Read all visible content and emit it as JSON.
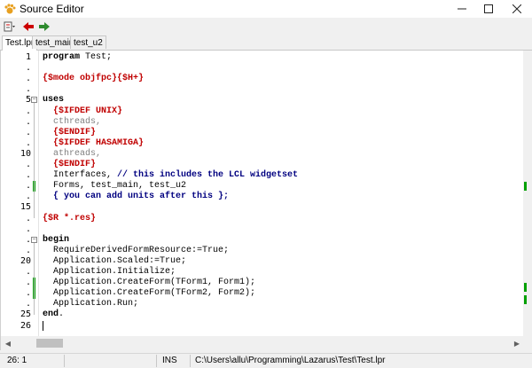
{
  "window": {
    "title": "Source Editor",
    "icon": "lazarus-paw-icon",
    "controls": [
      "minimize-icon",
      "maximize-icon",
      "close-icon"
    ]
  },
  "toolbar": {
    "buttons": [
      "jump-menu-icon",
      "back-arrow-icon",
      "forward-arrow-icon"
    ],
    "back_color": "#cc0000",
    "forward_color": "#2e8b2e"
  },
  "tabs": [
    {
      "label": "Test.lpr",
      "active": true
    },
    {
      "label": "test_main",
      "active": false
    },
    {
      "label": "test_u2",
      "active": false
    }
  ],
  "gutter": [
    {
      "label": "1"
    },
    {
      "label": "."
    },
    {
      "label": "."
    },
    {
      "label": "."
    },
    {
      "label": "5"
    },
    {
      "label": "."
    },
    {
      "label": "."
    },
    {
      "label": "."
    },
    {
      "label": "."
    },
    {
      "label": "10"
    },
    {
      "label": "."
    },
    {
      "label": "."
    },
    {
      "label": "."
    },
    {
      "label": "."
    },
    {
      "label": "15"
    },
    {
      "label": "."
    },
    {
      "label": "."
    },
    {
      "label": "."
    },
    {
      "label": "."
    },
    {
      "label": "20"
    },
    {
      "label": "."
    },
    {
      "label": "."
    },
    {
      "label": "."
    },
    {
      "label": "."
    },
    {
      "label": "25"
    },
    {
      "label": "26"
    }
  ],
  "code": [
    [
      {
        "t": "program",
        "c": "kw"
      },
      {
        "t": " Test;",
        "c": ""
      }
    ],
    [],
    [
      {
        "t": "{$mode objfpc}{$H+}",
        "c": "dir"
      }
    ],
    [],
    [
      {
        "t": "uses",
        "c": "kw"
      }
    ],
    [
      {
        "t": "  ",
        "c": ""
      },
      {
        "t": "{$IFDEF UNIX}",
        "c": "dir"
      }
    ],
    [
      {
        "t": "  cthreads,",
        "c": "inact"
      }
    ],
    [
      {
        "t": "  ",
        "c": ""
      },
      {
        "t": "{$ENDIF}",
        "c": "dir"
      }
    ],
    [
      {
        "t": "  ",
        "c": ""
      },
      {
        "t": "{$IFDEF HASAMIGA}",
        "c": "dir"
      }
    ],
    [
      {
        "t": "  athreads,",
        "c": "inact"
      }
    ],
    [
      {
        "t": "  ",
        "c": ""
      },
      {
        "t": "{$ENDIF}",
        "c": "dir"
      }
    ],
    [
      {
        "t": "  Interfaces, ",
        "c": ""
      },
      {
        "t": "// this includes the LCL widgetset",
        "c": "cmt"
      }
    ],
    [
      {
        "t": "  Forms, test_main, test_u2",
        "c": ""
      }
    ],
    [
      {
        "t": "  ",
        "c": ""
      },
      {
        "t": "{ you can add units after this };",
        "c": "cmt"
      }
    ],
    [],
    [
      {
        "t": "{$R *.res}",
        "c": "dir"
      }
    ],
    [],
    [
      {
        "t": "begin",
        "c": "kw"
      }
    ],
    [
      {
        "t": "  RequireDerivedFormResource:=True;",
        "c": ""
      }
    ],
    [
      {
        "t": "  Application.Scaled:=True;",
        "c": ""
      }
    ],
    [
      {
        "t": "  Application.Initialize;",
        "c": ""
      }
    ],
    [
      {
        "t": "  Application.CreateForm(TForm1, Form1);",
        "c": ""
      }
    ],
    [
      {
        "t": "  Application.CreateForm(TForm2, Form2);",
        "c": ""
      }
    ],
    [
      {
        "t": "  Application.Run;",
        "c": ""
      }
    ],
    [
      {
        "t": "end",
        "c": "kw"
      },
      {
        "t": ".",
        "c": ""
      }
    ],
    []
  ],
  "modified_line_indices": [
    12,
    21,
    22
  ],
  "fold_line_indices": [
    4,
    17
  ],
  "cursor_line_index": 25,
  "colors": {
    "keyword": "#000000",
    "directive": "#c00000",
    "inactive": "#808080",
    "comment": "#000080",
    "modified_marker": "#00a000"
  },
  "statusbar": {
    "position": "26:  1",
    "mode": "INS",
    "filepath": "C:\\Users\\allu\\Programming\\Lazarus\\Test\\Test.lpr"
  }
}
